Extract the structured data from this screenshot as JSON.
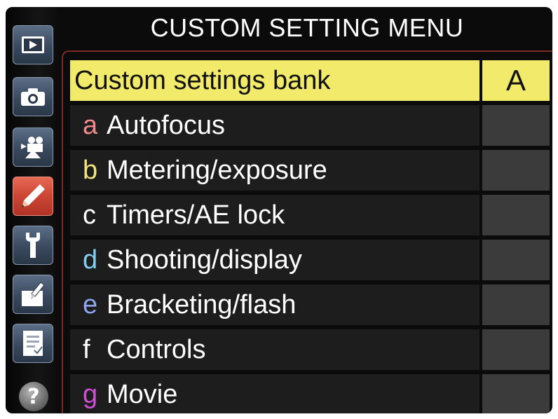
{
  "title": "CUSTOM SETTING MENU",
  "sidebar": {
    "tabs": [
      {
        "name": "playback-menu-tab",
        "icon": "playback-icon",
        "active": false
      },
      {
        "name": "shooting-menu-tab",
        "icon": "camera-icon",
        "active": false
      },
      {
        "name": "movie-menu-tab",
        "icon": "movie-camera-icon",
        "active": false
      },
      {
        "name": "custom-setting-menu-tab",
        "icon": "pencil-icon",
        "active": true
      },
      {
        "name": "setup-menu-tab",
        "icon": "wrench-icon",
        "active": false
      },
      {
        "name": "retouch-menu-tab",
        "icon": "retouch-brush-icon",
        "active": false
      },
      {
        "name": "my-menu-tab",
        "icon": "my-menu-list-icon",
        "active": false
      }
    ],
    "help": "?"
  },
  "menu": {
    "bank": {
      "label": "Custom settings bank",
      "value": "A"
    },
    "items": [
      {
        "letter": "a",
        "label": "Autofocus",
        "color": "#f08a8a"
      },
      {
        "letter": "b",
        "label": "Metering/exposure",
        "color": "#f3e37a"
      },
      {
        "letter": "c",
        "label": "Timers/AE lock",
        "color": "#ffffff"
      },
      {
        "letter": "d",
        "label": "Shooting/display",
        "color": "#7fd0f3"
      },
      {
        "letter": "e",
        "label": "Bracketing/flash",
        "color": "#8fa6f0"
      },
      {
        "letter": "f",
        "label": "Controls",
        "color": "#ffffff"
      },
      {
        "letter": "g",
        "label": "Movie",
        "color": "#d04fd8"
      }
    ]
  },
  "colors": {
    "highlight": "#f2ea6a",
    "active_tab": "#cc4534",
    "tab": "#3c4d63"
  }
}
